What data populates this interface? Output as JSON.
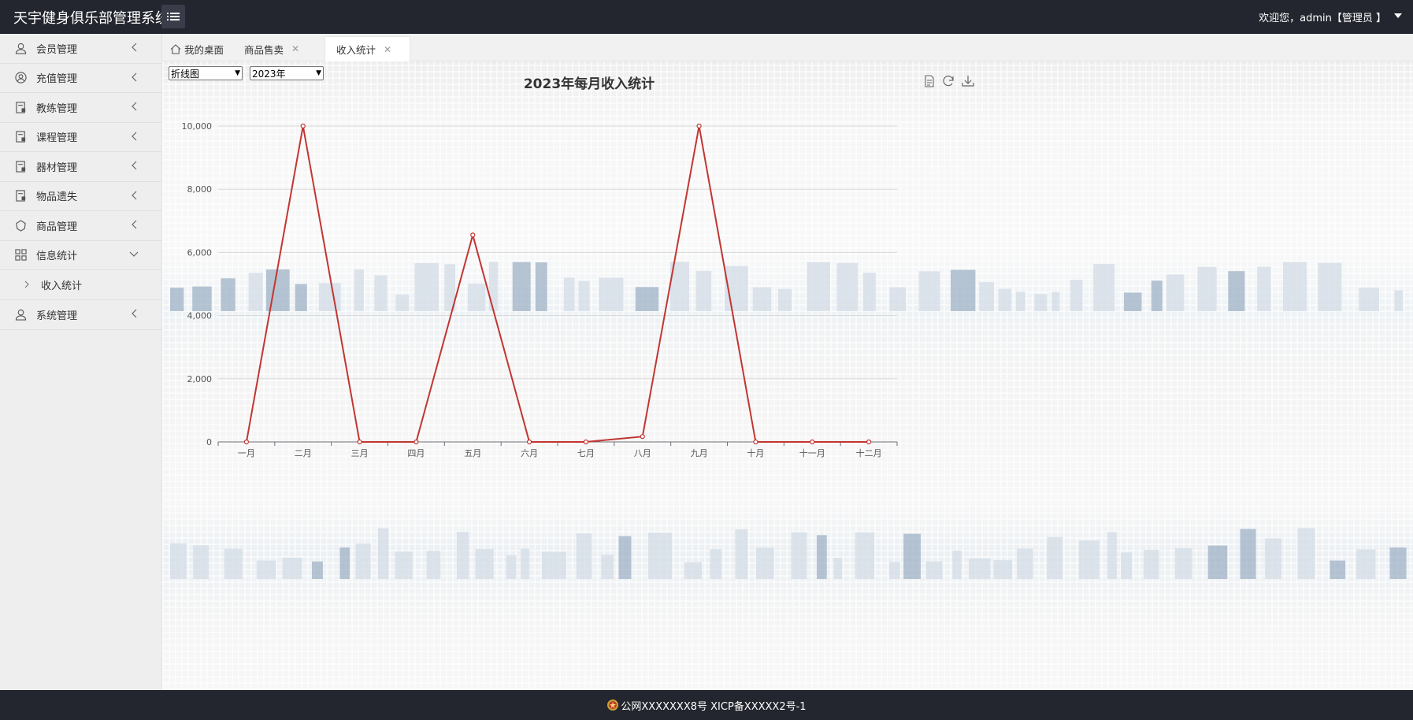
{
  "header": {
    "title": "天宇健身俱乐部管理系统",
    "welcome": "欢迎您，admin【管理员 】"
  },
  "sidebar": {
    "items": [
      {
        "label": "会员管理",
        "icon": "user-icon"
      },
      {
        "label": "充值管理",
        "icon": "user-circle-icon"
      },
      {
        "label": "教练管理",
        "icon": "form-icon"
      },
      {
        "label": "课程管理",
        "icon": "form-icon"
      },
      {
        "label": "器材管理",
        "icon": "form-icon"
      },
      {
        "label": "物品遗失",
        "icon": "form-icon"
      },
      {
        "label": "商品管理",
        "icon": "release-icon"
      },
      {
        "label": "信息统计",
        "icon": "grid-icon",
        "expanded": true
      },
      {
        "label": "收入统计",
        "sub": true
      },
      {
        "label": "系统管理",
        "icon": "user-icon"
      }
    ]
  },
  "tabs": [
    {
      "label": "我的桌面",
      "home": true
    },
    {
      "label": "商品售卖",
      "closable": true
    },
    {
      "label": "收入统计",
      "closable": true,
      "active": true
    }
  ],
  "filters": {
    "chart_type": "折线图",
    "year": "2023年"
  },
  "chart_data": {
    "type": "line",
    "title": "2023年每月收入统计",
    "categories": [
      "一月",
      "二月",
      "三月",
      "四月",
      "五月",
      "六月",
      "七月",
      "八月",
      "九月",
      "十月",
      "十一月",
      "十二月"
    ],
    "series": [
      {
        "values": [
          0,
          10000,
          0,
          0,
          6550,
          0,
          0,
          170,
          10000,
          0,
          0,
          0
        ]
      }
    ],
    "y_ticks": [
      "0",
      "2,000",
      "4,000",
      "6,000",
      "8,000",
      "10,000"
    ],
    "ylim": [
      0,
      10000
    ],
    "grid": true,
    "line_color": "#c23531"
  },
  "footer": {
    "text": "公网XXXXXXX8号 XICP备XXXXX2号-1"
  }
}
